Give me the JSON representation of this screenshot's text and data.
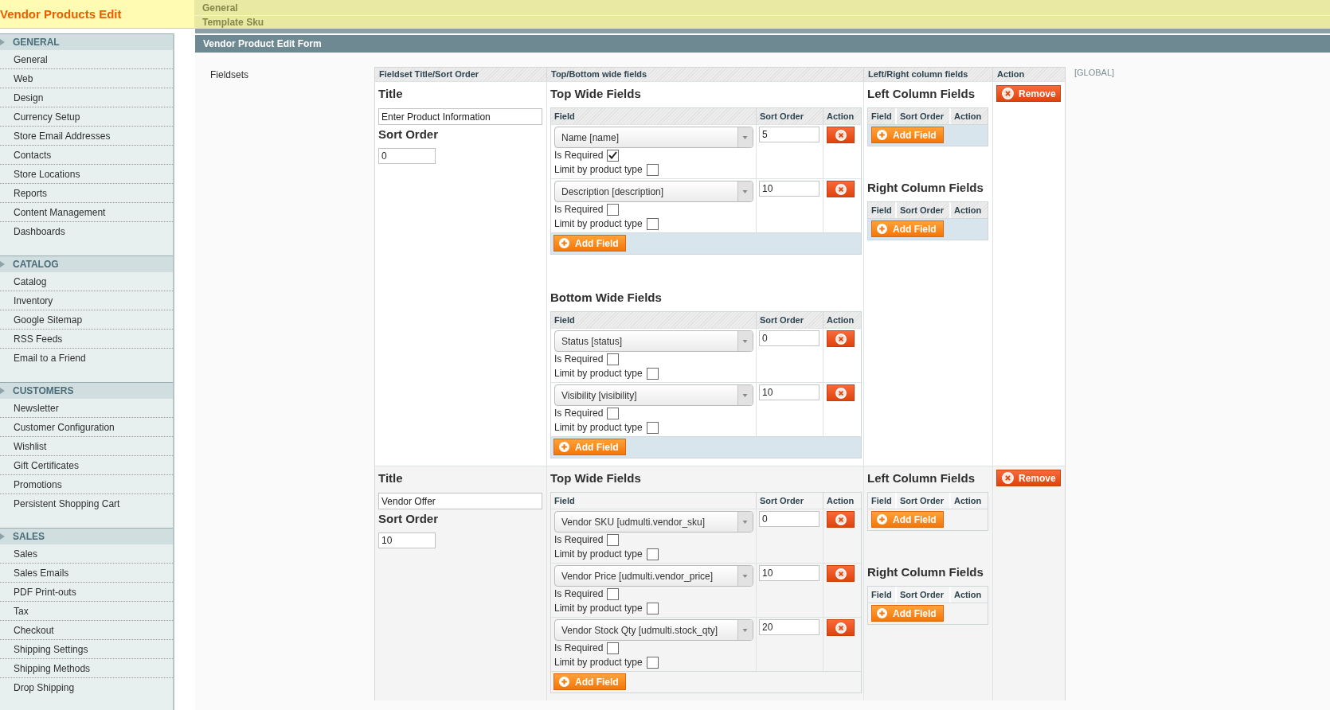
{
  "header": {
    "title": "Vendor Products Edit"
  },
  "page_sections": [
    {
      "title": "General"
    },
    {
      "title": "Template Sku"
    }
  ],
  "sidebar": {
    "sections": [
      {
        "title": "GENERAL",
        "items": [
          "General",
          "Web",
          "Design",
          "Currency Setup",
          "Store Email Addresses",
          "Contacts",
          "Store Locations",
          "Reports",
          "Content Management",
          "Dashboards"
        ]
      },
      {
        "title": "CATALOG",
        "items": [
          "Catalog",
          "Inventory",
          "Google Sitemap",
          "RSS Feeds",
          "Email to a Friend"
        ]
      },
      {
        "title": "CUSTOMERS",
        "items": [
          "Newsletter",
          "Customer Configuration",
          "Wishlist",
          "Gift Certificates",
          "Promotions",
          "Persistent Shopping Cart"
        ]
      },
      {
        "title": "SALES",
        "items": [
          "Sales",
          "Sales Emails",
          "PDF Print-outs",
          "Tax",
          "Checkout",
          "Shipping Settings",
          "Shipping Methods",
          "Drop Shipping"
        ]
      }
    ]
  },
  "form": {
    "title": "Vendor Product Edit Form",
    "field_label": "Fieldsets",
    "scope": "[GLOBAL]",
    "columns": [
      "Fieldset Title/Sort Order",
      "Top/Bottom wide fields",
      "Left/Right column fields",
      "Action"
    ],
    "fieldsets": [
      {
        "title_label": "Title",
        "title": "Enter Product Information",
        "sort_order_label": "Sort Order",
        "sort_order": "0",
        "wide_groups": [
          {
            "heading": "Top Wide Fields",
            "columns": [
              "Field",
              "Sort Order",
              "Action"
            ],
            "rows": [
              {
                "field": "Name [name]",
                "sort_order": "5",
                "required": {
                  "label": "Is Required",
                  "checked": true
                },
                "limit": {
                  "label": "Limit by product type",
                  "checked": false
                }
              },
              {
                "field": "Description [description]",
                "sort_order": "10",
                "required": {
                  "label": "Is Required",
                  "checked": false
                },
                "limit": {
                  "label": "Limit by product type",
                  "checked": false
                }
              }
            ],
            "add_label": "Add Field"
          },
          {
            "heading": "Bottom Wide Fields",
            "columns": [
              "Field",
              "Sort Order",
              "Action"
            ],
            "rows": [
              {
                "field": "Status [status]",
                "sort_order": "0",
                "required": {
                  "label": "Is Required",
                  "checked": false
                },
                "limit": {
                  "label": "Limit by product type",
                  "checked": false
                }
              },
              {
                "field": "Visibility [visibility]",
                "sort_order": "10",
                "required": {
                  "label": "Is Required",
                  "checked": false
                },
                "limit": {
                  "label": "Limit by product type",
                  "checked": false
                }
              }
            ],
            "add_label": "Add Field"
          }
        ],
        "column_groups": [
          {
            "heading": "Left Column Fields",
            "columns": [
              "Field",
              "Sort Order",
              "Action"
            ],
            "add_label": "Add Field"
          },
          {
            "heading": "Right Column Fields",
            "columns": [
              "Field",
              "Sort Order",
              "Action"
            ],
            "add_label": "Add Field"
          }
        ],
        "remove_label": "Remove"
      },
      {
        "title_label": "Title",
        "title": "Vendor Offer",
        "sort_order_label": "Sort Order",
        "sort_order": "10",
        "wide_groups": [
          {
            "heading": "Top Wide Fields",
            "columns": [
              "Field",
              "Sort Order",
              "Action"
            ],
            "rows": [
              {
                "field": "Vendor SKU [udmulti.vendor_sku]",
                "sort_order": "0",
                "required": {
                  "label": "Is Required",
                  "checked": false
                },
                "limit": {
                  "label": "Limit by product type",
                  "checked": false
                }
              },
              {
                "field": "Vendor Price [udmulti.vendor_price]",
                "sort_order": "10",
                "required": {
                  "label": "Is Required",
                  "checked": false
                },
                "limit": {
                  "label": "Limit by product type",
                  "checked": false
                }
              },
              {
                "field": "Vendor Stock Qty [udmulti.stock_qty]",
                "sort_order": "20",
                "required": {
                  "label": "Is Required",
                  "checked": false
                },
                "limit": {
                  "label": "Limit by product type",
                  "checked": false
                }
              }
            ],
            "add_label": "Add Field"
          }
        ],
        "column_groups": [
          {
            "heading": "Left Column Fields",
            "columns": [
              "Field",
              "Sort Order",
              "Action"
            ],
            "add_label": "Add Field"
          },
          {
            "heading": "Right Column Fields",
            "columns": [
              "Field",
              "Sort Order",
              "Action"
            ],
            "add_label": "Add Field"
          }
        ],
        "remove_label": "Remove"
      }
    ]
  }
}
